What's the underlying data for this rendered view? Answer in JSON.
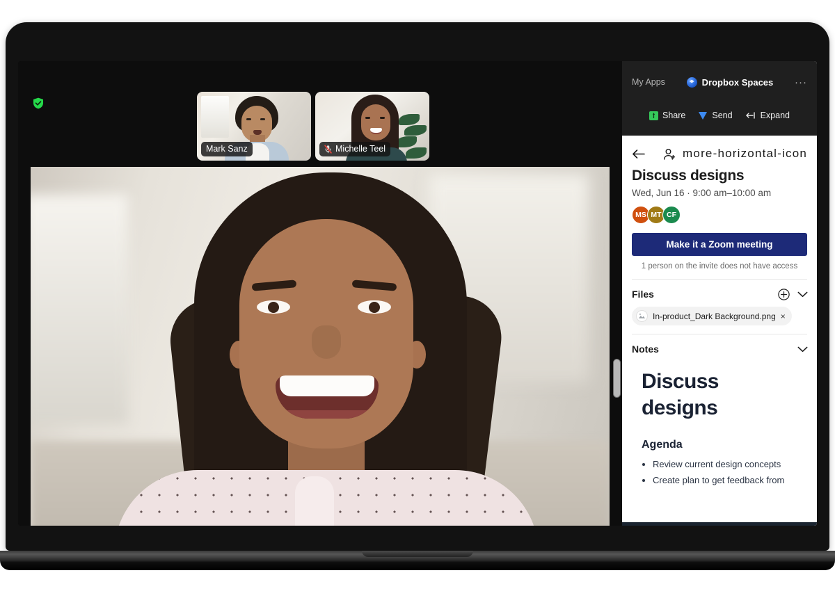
{
  "video": {
    "security_icon": "shield-check-icon",
    "participants": [
      {
        "name": "Mark Sanz",
        "muted": false
      },
      {
        "name": "Michelle Teel",
        "muted": true
      }
    ],
    "active_speaker": "Michelle Teel"
  },
  "panel": {
    "topbar": {
      "my_apps": "My Apps",
      "app_title": "Dropbox Spaces",
      "app_logo": "dropbox-spaces-logo-icon",
      "overflow": "···",
      "actions": [
        {
          "label": "Share",
          "icon": "share-upload-icon"
        },
        {
          "label": "Send",
          "icon": "send-plane-icon"
        },
        {
          "label": "Expand",
          "icon": "expand-arrow-icon"
        }
      ]
    },
    "header": {
      "back_icon": "back-arrow-icon",
      "person_add_icon": "person-add-icon",
      "more_icon": "more-horizontal-icon"
    },
    "meeting": {
      "title": "Discuss designs",
      "time": "Wed, Jun 16 · 9:00 am–10:00 am",
      "attendees": [
        {
          "initials": "MS",
          "color": "#d0500f"
        },
        {
          "initials": "MT",
          "color": "#a07a16"
        },
        {
          "initials": "CF",
          "color": "#1a8a4e"
        }
      ],
      "zoom_button": "Make it a Zoom meeting",
      "access_note": "1 person on the invite does not have access"
    },
    "files": {
      "title": "Files",
      "add_icon": "plus-circle-icon",
      "collapse_icon": "chevron-down-icon",
      "items": [
        {
          "name": "In-product_Dark Background.png",
          "icon": "image-file-icon",
          "remove": "×"
        }
      ]
    },
    "notes": {
      "title": "Notes",
      "collapse_icon": "chevron-down-icon",
      "doc_title": "Discuss designs",
      "agenda_heading": "Agenda",
      "agenda_items": [
        "Review current design concepts",
        "Create plan to get feedback from"
      ]
    },
    "toolbar": [
      {
        "icon": "new-window-icon"
      },
      {
        "icon": "dropbox-icon"
      },
      {
        "icon": "grid-table-icon"
      },
      {
        "icon": "calendar-icon"
      },
      {
        "icon": "checkbox-icon"
      },
      {
        "icon": "bullet-list-icon"
      },
      {
        "icon": "numbered-list-icon"
      },
      {
        "icon": "help-question-icon"
      }
    ]
  },
  "colors": {
    "accent_blue": "#1d2a78",
    "share_green": "#35c95a",
    "send_blue": "#3d8bf2",
    "toolbar_bg": "#1a2430",
    "topbar_bg": "#1f1f1f",
    "mute_red": "#e8453c"
  }
}
